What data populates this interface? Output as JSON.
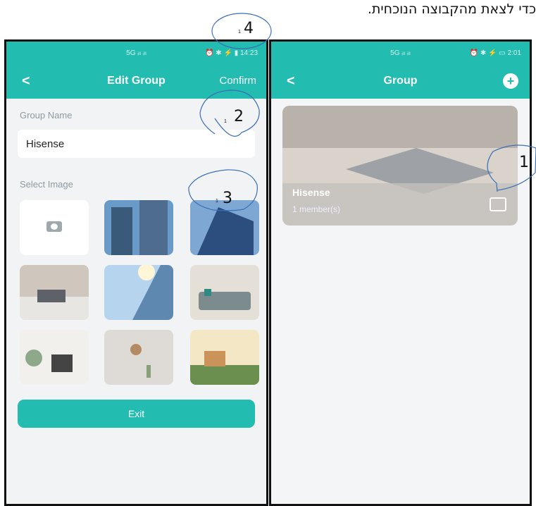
{
  "caption": "כדי לצאת מהקבוצה הנוכחית.",
  "left_screen": {
    "status": {
      "signal": "5G ᵢₗₗ ᵢₗₗ",
      "right": "⏰ ✱ ⚡ ▮ 14:23"
    },
    "appbar": {
      "back": "<",
      "title": "Edit Group",
      "confirm": "Confirm"
    },
    "group_name_label": "Group Name",
    "group_name_value": "Hisense",
    "select_image_label": "Select Image",
    "exit_label": "Exit"
  },
  "right_screen": {
    "status": {
      "signal": "5G ᵢₗₗ ᵢₗₗ",
      "right": "⏰ ✱ ⚡ ▭ 2:01"
    },
    "appbar": {
      "back": "<",
      "title": "Group",
      "add": "+"
    },
    "card": {
      "name": "Hisense",
      "members": "1 member(s)"
    }
  },
  "callouts": [
    {
      "number": "4",
      "sub": "1"
    },
    {
      "number": "2",
      "sub": "1"
    },
    {
      "number": "3",
      "sub": "1"
    },
    {
      "number": "1",
      "sub": ""
    }
  ],
  "colors": {
    "accent": "#22bcb0",
    "background": "#f1f3f4"
  }
}
